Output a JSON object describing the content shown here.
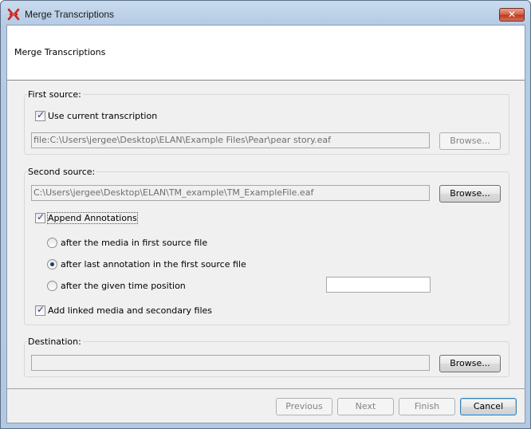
{
  "window": {
    "title": "Merge Transcriptions",
    "close_glyph": "✕"
  },
  "header": {
    "title": "Merge Transcriptions"
  },
  "first_source": {
    "label": "First source:",
    "use_current_label": "Use current transcription",
    "use_current_checked": true,
    "path": "file:C:\\Users\\jergee\\Desktop\\ELAN\\Example Files\\Pear\\pear story.eaf",
    "browse_label": "Browse..."
  },
  "second_source": {
    "label": "Second source:",
    "path": "C:\\Users\\jergee\\Desktop\\ELAN\\TM_example\\TM_ExampleFile.eaf",
    "browse_label": "Browse...",
    "append_label": "Append Annotations",
    "append_checked": true,
    "options": [
      {
        "label": "after the media in first source file",
        "selected": false
      },
      {
        "label": "after last annotation in the first source file",
        "selected": true
      },
      {
        "label": "after the given time position",
        "selected": false
      }
    ],
    "time_position_value": "",
    "linked_media_label": "Add linked media and secondary files",
    "linked_media_checked": true
  },
  "destination": {
    "label": "Destination:",
    "path": "",
    "browse_label": "Browse..."
  },
  "footer": {
    "previous_label": "Previous",
    "next_label": "Next",
    "finish_label": "Finish",
    "cancel_label": "Cancel"
  },
  "icons": {
    "app_icon": "elan-logo-icon",
    "close_icon": "close-icon",
    "check_icon": "checkmark-icon"
  },
  "colors": {
    "title_gradient_top": "#c9dbee",
    "close_button": "#c0391f",
    "check_mark": "#2a3e8e",
    "radio_dot": "#1f3b71"
  }
}
